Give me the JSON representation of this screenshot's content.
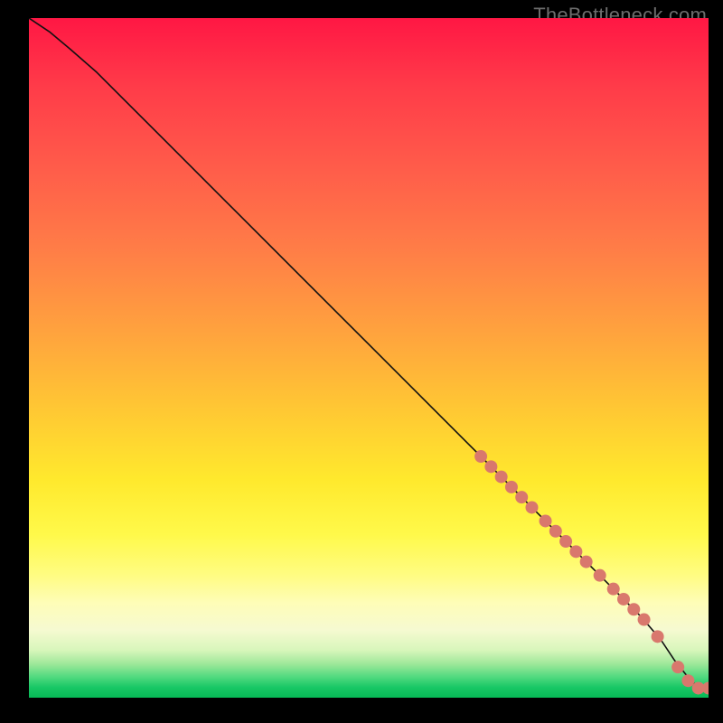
{
  "watermark": "TheBottleneck.com",
  "chart_data": {
    "type": "line",
    "title": "",
    "xlabel": "",
    "ylabel": "",
    "xlim": [
      0,
      100
    ],
    "ylim": [
      0,
      100
    ],
    "curve": {
      "x": [
        0,
        3,
        6,
        10,
        20,
        30,
        40,
        50,
        60,
        70,
        75,
        80,
        85,
        90,
        93,
        95,
        97,
        98.5,
        100
      ],
      "y": [
        100,
        98,
        95.5,
        92,
        82,
        72,
        62,
        52,
        42,
        32,
        27,
        22,
        17,
        12,
        8.5,
        5.5,
        3,
        1.4,
        1.4
      ]
    },
    "series": [
      {
        "name": "points",
        "x": [
          66.5,
          68,
          69.5,
          71,
          72.5,
          74,
          76,
          77.5,
          79,
          80.5,
          82,
          84,
          86,
          87.5,
          89,
          90.5,
          92.5,
          95.5,
          97,
          98.5,
          100
        ],
        "y": [
          35.5,
          34,
          32.5,
          31,
          29.5,
          28,
          26,
          24.5,
          23,
          21.5,
          20,
          18,
          16,
          14.5,
          13,
          11.5,
          9,
          4.5,
          2.5,
          1.4,
          1.4
        ]
      }
    ]
  }
}
